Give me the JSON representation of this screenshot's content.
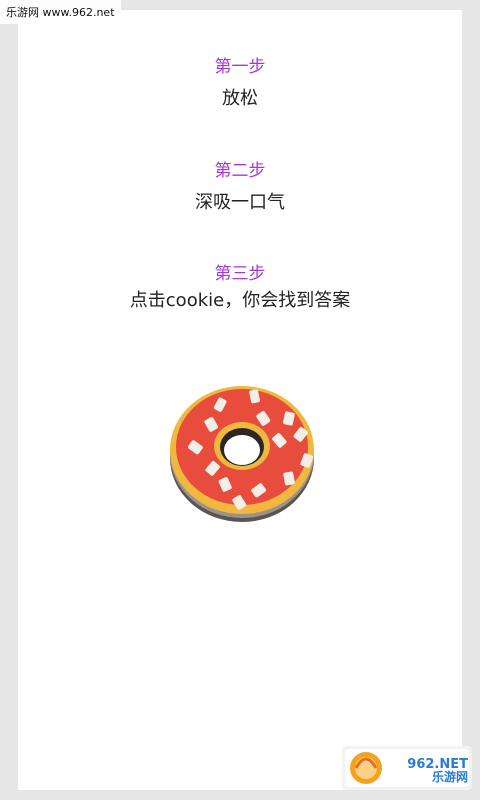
{
  "watermark": {
    "top_left": "乐游网 www.962.net",
    "bottom_right_brand": "962.NET",
    "bottom_right_cn": "乐游网"
  },
  "steps": [
    {
      "title": "第一步",
      "text": "放松"
    },
    {
      "title": "第二步",
      "text": "深吸一口气"
    },
    {
      "title": "第三步",
      "text": "点击cookie，你会找到答案"
    }
  ],
  "icons": {
    "cookie": "donut-icon"
  },
  "colors": {
    "step_title": "#a43ad5",
    "background": "#e7e7e7",
    "card": "#ffffff"
  }
}
